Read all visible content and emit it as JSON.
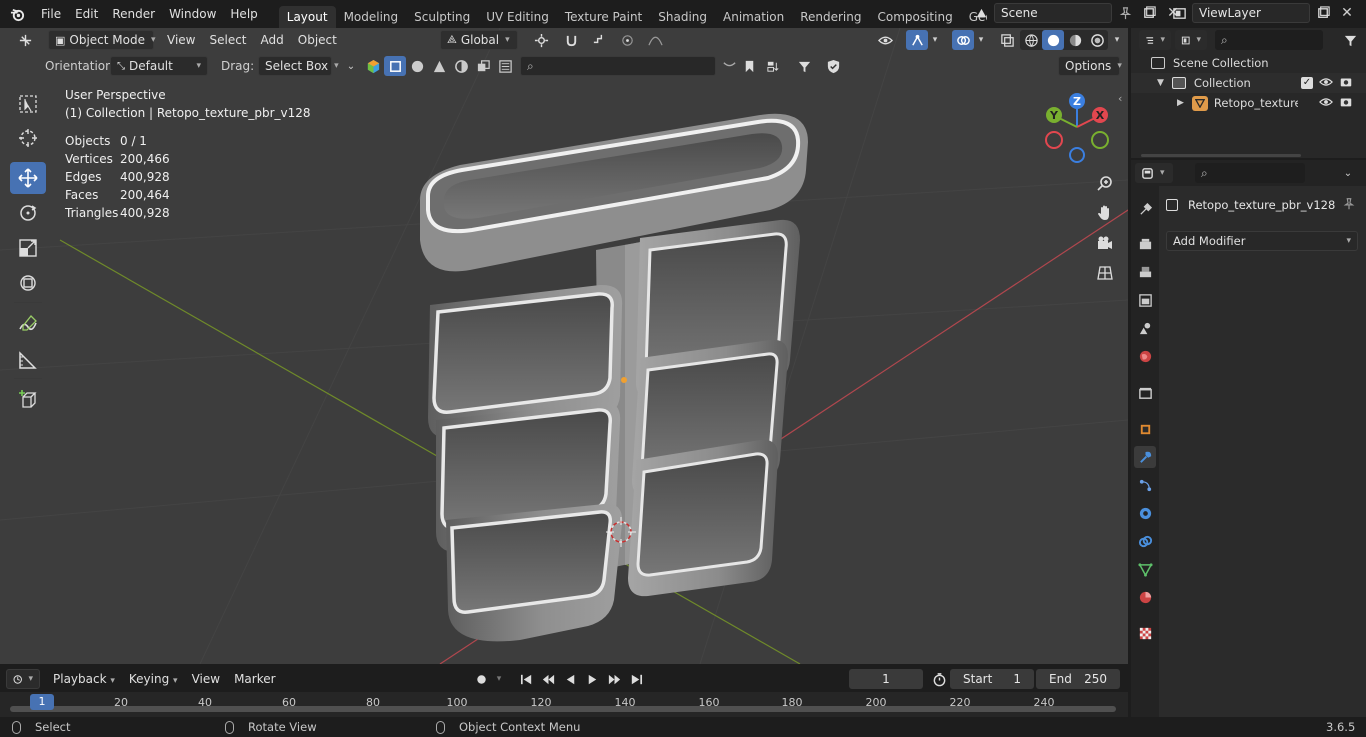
{
  "topbar": {
    "menus": [
      "File",
      "Edit",
      "Render",
      "Window",
      "Help"
    ],
    "workspaces": [
      "Layout",
      "Modeling",
      "Sculpting",
      "UV Editing",
      "Texture Paint",
      "Shading",
      "Animation",
      "Rendering",
      "Compositing",
      "Geometry Noc"
    ],
    "active_workspace": "Layout",
    "scene": "Scene",
    "view_layer": "ViewLayer"
  },
  "viewport_header": {
    "mode": "Object Mode",
    "menus": [
      "View",
      "Select",
      "Add",
      "Object"
    ],
    "transform_orientation": "Global"
  },
  "tool_settings": {
    "orientation_label": "Orientation:",
    "orientation_value": "Default",
    "drag_label": "Drag:",
    "drag_value": "Select Box",
    "options_label": "Options"
  },
  "viewport": {
    "view_name": "User Perspective",
    "context": "(1) Collection | Retopo_texture_pbr_v128",
    "stats": [
      {
        "label": "Objects",
        "value": "0 / 1"
      },
      {
        "label": "Vertices",
        "value": "200,466"
      },
      {
        "label": "Edges",
        "value": "400,928"
      },
      {
        "label": "Faces",
        "value": "200,464"
      },
      {
        "label": "Triangles",
        "value": "400,928"
      }
    ],
    "gizmo_axes": {
      "x": "X",
      "y": "Y",
      "z": "Z"
    }
  },
  "outliner": {
    "scene_collection": "Scene Collection",
    "collection": "Collection",
    "object": "Retopo_texture_"
  },
  "properties": {
    "object_name": "Retopo_texture_pbr_v128",
    "add_modifier": "Add Modifier"
  },
  "timeline": {
    "menus": [
      "Playback",
      "Keying",
      "View",
      "Marker"
    ],
    "current_frame": "1",
    "start_label": "Start",
    "start_value": "1",
    "end_label": "End",
    "end_value": "250",
    "playhead_frame": "1",
    "ruler": [
      "20",
      "40",
      "60",
      "80",
      "100",
      "120",
      "140",
      "160",
      "180",
      "200",
      "220",
      "240"
    ]
  },
  "statusbar": {
    "select": "Select",
    "rotate": "Rotate View",
    "context_menu": "Object Context Menu",
    "version": "3.6.5"
  },
  "colors": {
    "accent": "#4772b3",
    "axis_x": "#e2474f",
    "axis_y": "#79b02f",
    "axis_z": "#3b7fe0",
    "viewport_bg": "#3c3c3c"
  }
}
